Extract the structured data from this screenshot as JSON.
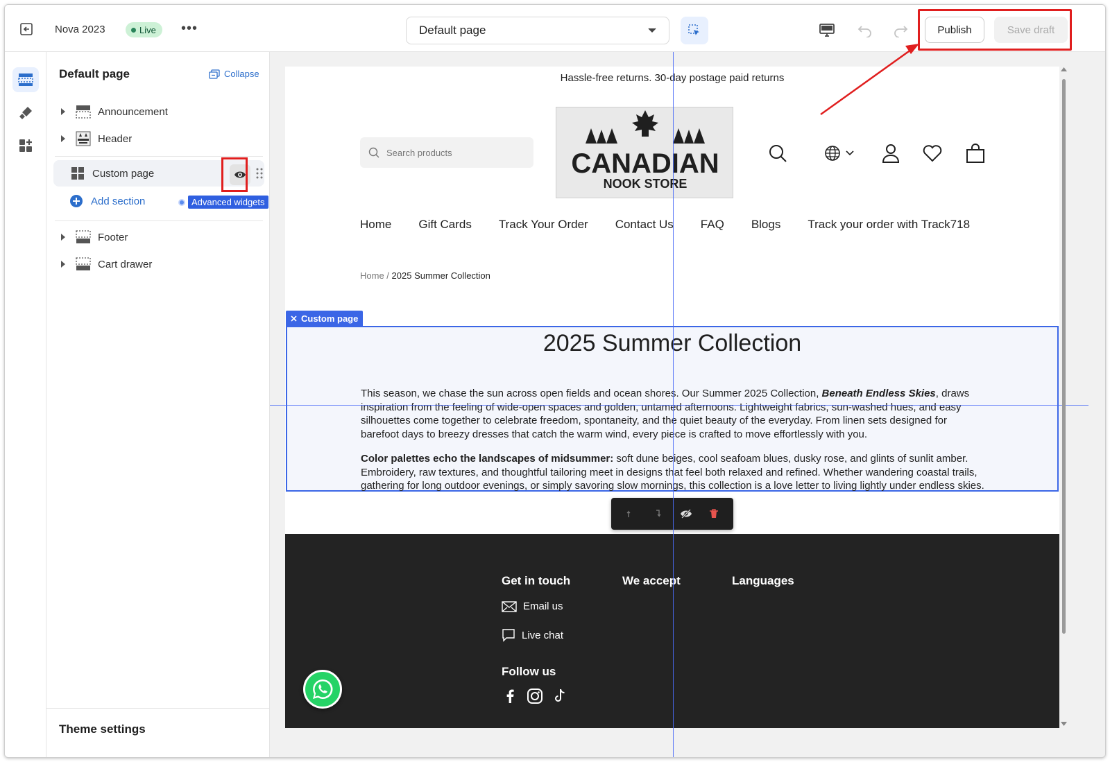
{
  "topbar": {
    "theme_name": "Nova 2023",
    "status": "Live",
    "more": "•••",
    "page_select": "Default page",
    "publish_label": "Publish",
    "save_draft_label": "Save draft"
  },
  "panel": {
    "title": "Default page",
    "collapse_label": "Collapse",
    "sections": [
      {
        "label": "Announcement",
        "icon": "section-layout-icon"
      },
      {
        "label": "Header",
        "icon": "store-logo-icon"
      },
      {
        "label": "Custom page",
        "icon": "grid-blocks-icon"
      },
      {
        "label": "Footer",
        "icon": "section-layout-icon"
      },
      {
        "label": "Cart drawer",
        "icon": "section-layout-icon"
      }
    ],
    "add_section_label": "Add section",
    "advanced_widgets_label": "Advanced widgets",
    "theme_settings_label": "Theme settings"
  },
  "store": {
    "announcement": "Hassle-free returns. 30-day postage paid returns",
    "search_placeholder": "Search products",
    "logo_text_main": "CANADIAN",
    "logo_text_sub": "NOOK STORE",
    "nav": [
      "Home",
      "Gift Cards",
      "Track Your Order",
      "Contact Us",
      "FAQ",
      "Blogs",
      "Track your order with Track718"
    ],
    "breadcrumb_home": "Home",
    "breadcrumb_sep": " / ",
    "breadcrumb_current": "2025 Summer Collection",
    "section_tag": "Custom page",
    "collection_title": "2025 Summer Collection",
    "p1_before": "This season, we chase the sun across open fields and ocean shores. Our Summer 2025 Collection, ",
    "p1_em": "Beneath Endless Skies",
    "p1_after": ", draws inspiration from the feeling of wide-open spaces and golden, untamed afternoons. Lightweight fabrics, sun-washed hues, and easy silhouettes come together to celebrate freedom, spontaneity, and the quiet beauty of the everyday. From linen sets designed for barefoot days to breezy dresses that catch the warm wind, every piece is crafted to move effortlessly with you.",
    "p2_strong": "Color palettes echo the landscapes of midsummer:",
    "p2_after": " soft dune beiges, cool seafoam blues, dusky rose, and glints of sunlit amber. Embroidery, raw textures, and thoughtful tailoring meet in designs that feel both relaxed and refined. Whether wandering coastal trails, gathering for long outdoor evenings, or simply savoring slow mornings, this collection is a love letter to living lightly under endless skies."
  },
  "footer": {
    "get_in_touch": "Get in touch",
    "we_accept": "We accept",
    "languages": "Languages",
    "email_us": "Email us",
    "live_chat": "Live chat",
    "follow_us": "Follow us"
  },
  "colors": {
    "accent": "#2c6ecb",
    "selection": "#3b66e6",
    "highlight": "#e01e1e",
    "footer_bg": "#232323",
    "live_badge": "#cdf1d6"
  }
}
